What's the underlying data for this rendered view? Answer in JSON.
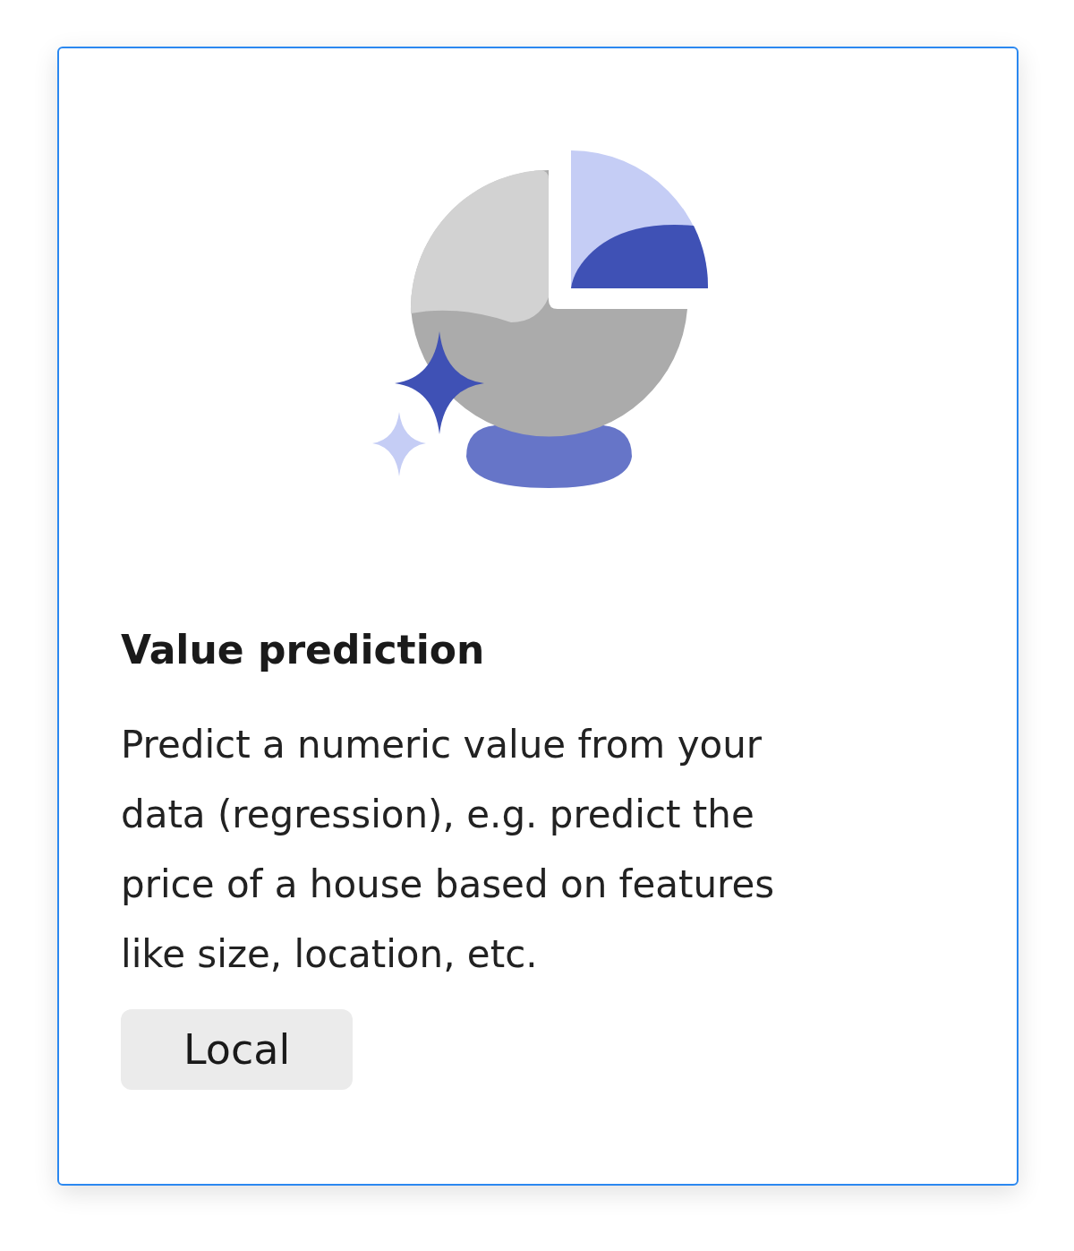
{
  "card": {
    "selected": true,
    "title": "Value prediction",
    "description": "Predict a numeric value from your data (regression), e.g. predict the price of a house based on features like size, location, etc.",
    "tag": "Local"
  }
}
